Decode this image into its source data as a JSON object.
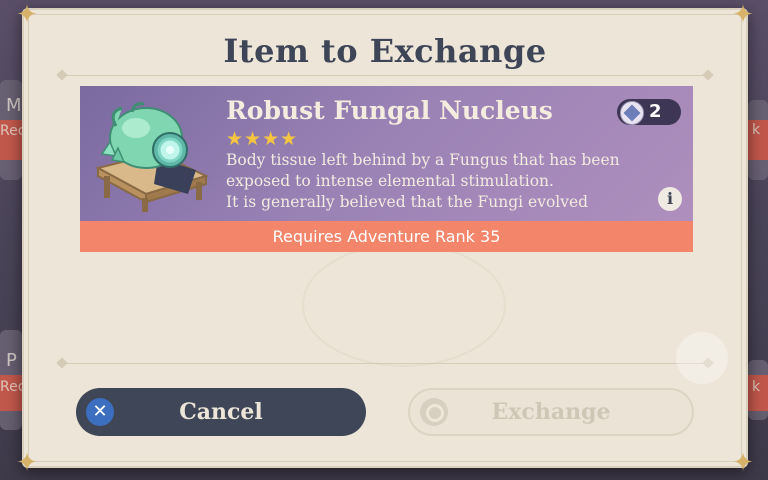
{
  "background": {
    "left_labels": [
      "M",
      "Rec",
      "P",
      "Rec"
    ],
    "right_labels": [
      "k",
      "k"
    ]
  },
  "dialog": {
    "title": "Item to Exchange"
  },
  "item": {
    "name": "Robust Fungal Nucleus",
    "rarity_stars": "★★★★",
    "rarity": 4,
    "description": "Body tissue left behind by a Fungus that has been exposed to intense elemental stimulation.\nIt is generally believed that the Fungi evolved",
    "owned_count": "2",
    "info_label": "i",
    "requirement": "Requires Adventure Rank 35",
    "icon": "fungal-nucleus-icon"
  },
  "buttons": {
    "cancel_label": "Cancel",
    "cancel_icon": "x-icon",
    "exchange_label": "Exchange",
    "exchange_icon": "circle-icon",
    "exchange_enabled": false
  },
  "colors": {
    "dialog_bg": "#ece5d8",
    "title": "#3d4557",
    "card_purple": "#9a82b5",
    "requirement_bar": "#f2856a",
    "star_gold": "#f5c542",
    "cancel_bg": "#3e4658",
    "cancel_icon": "#3c6fbf"
  }
}
